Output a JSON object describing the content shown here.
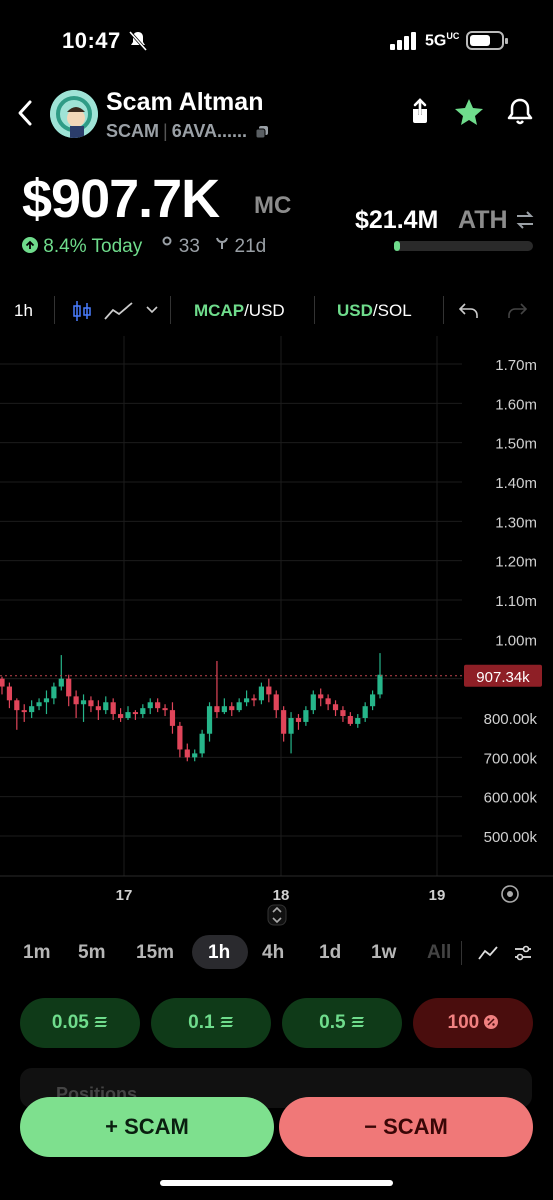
{
  "status_bar": {
    "time": "10:47",
    "network": "5G",
    "network_sup": "UC"
  },
  "header": {
    "title": "Scam Altman",
    "ticker": "SCAM",
    "address": "6AVA......",
    "icons": [
      "back-icon",
      "share-icon",
      "star-icon",
      "bell-icon",
      "copy-icon"
    ]
  },
  "stats": {
    "market_cap": "$907.7K",
    "market_cap_label": "MC",
    "change": "8.4%",
    "change_period": "Today",
    "holders": "33",
    "age": "21d",
    "ath_value": "$21.4M",
    "ath_label": "ATH",
    "ath_progress": 0.04
  },
  "toolbar": {
    "interval": "1h",
    "mcap_label": "MCAP",
    "mcap_unit": "/USD",
    "usd_label": "USD",
    "usd_unit": "/SOL"
  },
  "chart_data": {
    "type": "candlestick",
    "current_price_label": "907.34k",
    "current_price": 907.34,
    "y_ticks": [
      "1.70m",
      "1.60m",
      "1.50m",
      "1.40m",
      "1.30m",
      "1.20m",
      "1.10m",
      "1.00m",
      "800.00k",
      "700.00k",
      "600.00k",
      "500.00k"
    ],
    "y_tick_values": [
      1700,
      1600,
      1500,
      1400,
      1300,
      1200,
      1100,
      1000,
      800,
      700,
      600,
      500
    ],
    "x_ticks": [
      "17",
      "18",
      "19"
    ],
    "ylim": [
      430,
      1760
    ],
    "candles": [
      [
        900,
        880,
        905,
        860
      ],
      [
        880,
        845,
        890,
        825
      ],
      [
        845,
        820,
        850,
        770
      ],
      [
        820,
        815,
        835,
        790
      ],
      [
        815,
        830,
        845,
        800
      ],
      [
        830,
        840,
        850,
        820
      ],
      [
        840,
        850,
        870,
        810
      ],
      [
        850,
        880,
        890,
        835
      ],
      [
        880,
        900,
        960,
        870
      ],
      [
        900,
        855,
        910,
        830
      ],
      [
        855,
        835,
        870,
        800
      ],
      [
        835,
        845,
        860,
        790
      ],
      [
        845,
        830,
        855,
        815
      ],
      [
        830,
        820,
        845,
        795
      ],
      [
        820,
        840,
        855,
        810
      ],
      [
        840,
        810,
        850,
        795
      ],
      [
        810,
        800,
        825,
        790
      ],
      [
        800,
        815,
        830,
        795
      ],
      [
        815,
        810,
        820,
        795
      ],
      [
        810,
        825,
        835,
        800
      ],
      [
        825,
        840,
        850,
        810
      ],
      [
        840,
        825,
        850,
        815
      ],
      [
        825,
        820,
        835,
        805
      ],
      [
        820,
        780,
        840,
        760
      ],
      [
        780,
        720,
        790,
        700
      ],
      [
        720,
        700,
        735,
        690
      ],
      [
        700,
        710,
        720,
        690
      ],
      [
        710,
        760,
        770,
        700
      ],
      [
        760,
        830,
        840,
        740
      ],
      [
        830,
        815,
        945,
        800
      ],
      [
        815,
        830,
        850,
        810
      ],
      [
        830,
        820,
        840,
        805
      ],
      [
        820,
        840,
        850,
        815
      ],
      [
        840,
        850,
        870,
        830
      ],
      [
        850,
        845,
        860,
        830
      ],
      [
        845,
        880,
        890,
        835
      ],
      [
        880,
        860,
        900,
        840
      ],
      [
        860,
        820,
        870,
        800
      ],
      [
        820,
        760,
        830,
        740
      ],
      [
        760,
        800,
        815,
        710
      ],
      [
        800,
        790,
        810,
        770
      ],
      [
        790,
        820,
        830,
        780
      ],
      [
        820,
        860,
        870,
        810
      ],
      [
        860,
        850,
        875,
        830
      ],
      [
        850,
        835,
        860,
        820
      ],
      [
        835,
        820,
        845,
        805
      ],
      [
        820,
        805,
        830,
        790
      ],
      [
        805,
        785,
        815,
        780
      ],
      [
        785,
        800,
        810,
        775
      ],
      [
        800,
        830,
        840,
        790
      ],
      [
        830,
        860,
        870,
        820
      ],
      [
        860,
        910,
        965,
        850
      ]
    ]
  },
  "timeframes": [
    "1m",
    "5m",
    "15m",
    "1h",
    "4h",
    "1d",
    "1w",
    "All"
  ],
  "active_timeframe": "1h",
  "amounts": [
    {
      "label": "0.05",
      "icon": "solana-icon"
    },
    {
      "label": "0.1",
      "icon": "solana-icon"
    },
    {
      "label": "0.5",
      "icon": "solana-icon"
    },
    {
      "label": "100",
      "icon": "percent-icon"
    }
  ],
  "positions_label": "Positions",
  "actions": {
    "buy_label": "+ SCAM",
    "sell_label": "− SCAM"
  },
  "colors": {
    "accent_green": "#6fdc8c",
    "accent_red": "#f07878",
    "candle_up": "#26b58a",
    "candle_down": "#e0455a",
    "background": "#000000"
  }
}
